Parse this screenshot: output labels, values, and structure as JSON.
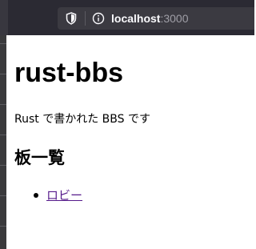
{
  "browser": {
    "url_host": "localhost",
    "url_port": ":3000"
  },
  "page": {
    "title": "rust-bbs",
    "description": "Rust で書かれた BBS です",
    "boards_heading": "板一覧",
    "boards": [
      {
        "label": "ロビー"
      }
    ]
  },
  "colors": {
    "toolbar_bg": "#2b2a33",
    "urlbar_bg": "#3b3a41",
    "visited_link": "#551a8b"
  }
}
